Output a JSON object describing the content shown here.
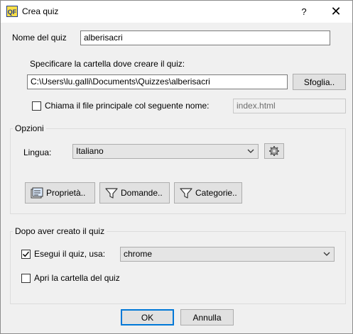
{
  "window": {
    "title": "Crea quiz",
    "help_label": "?",
    "close_label": "✕",
    "app_icon_text": "QF"
  },
  "quiz_name": {
    "label": "Nome del quiz",
    "value": "alberisacri"
  },
  "folder": {
    "label": "Specificare la cartella dove creare il quiz:",
    "path": "C:\\Users\\lu.galli\\Documents\\Quizzes\\alberisacri",
    "browse_label": "Sfoglia.."
  },
  "main_file": {
    "label": "Chiama il file principale col seguente nome:",
    "checked": false,
    "value": "index.html"
  },
  "options": {
    "title": "Opzioni",
    "language_label": "Lingua:",
    "language_value": "Italiano",
    "buttons": {
      "properties": "Proprietà..",
      "questions": "Domande..",
      "categories": "Categorie.."
    }
  },
  "after_create": {
    "title": "Dopo aver creato il quiz",
    "run_label": "Esegui il quiz, usa:",
    "run_checked": true,
    "browser_value": "chrome",
    "open_folder_label": "Apri la cartella del quiz",
    "open_folder_checked": false
  },
  "footer": {
    "ok_label": "OK",
    "cancel_label": "Annulla"
  }
}
